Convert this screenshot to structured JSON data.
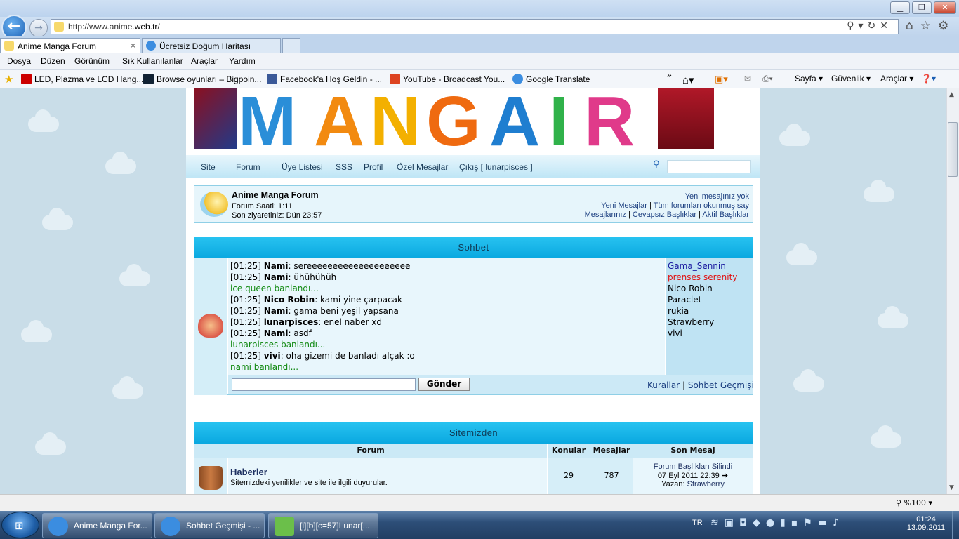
{
  "browser": {
    "url_prefix": "http://www.anime.",
    "url_domain": "web.tr",
    "url_suffix": "/",
    "tabs": [
      {
        "label": "Anime Manga Forum",
        "close": "×"
      },
      {
        "label": "Ücretsiz Doğum Haritası"
      }
    ],
    "menu": [
      "Dosya",
      "Düzen",
      "Görünüm",
      "Sık Kullanılanlar",
      "Araçlar",
      "Yardım"
    ],
    "favorites": [
      "LED, Plazma ve LCD Hang...",
      "Browse oyunları – Bigpoin...",
      "Facebook'a Hoş Geldin - ...",
      "YouTube - Broadcast You...",
      "Google Translate"
    ],
    "commands": [
      "Sayfa",
      "Güvenlik",
      "Araçlar"
    ],
    "zoom": "%100",
    "overflow": "»"
  },
  "site": {
    "nav": [
      "Site",
      "Forum",
      "Üye Listesi",
      "SSS",
      "Profil",
      "Özel Mesajlar",
      "Çıkış [ lunarpisces ]"
    ],
    "info": {
      "title": "Anime Manga Forum",
      "time": "Forum Saati: 1:11",
      "last_visit": "Son ziyaretiniz: Dün 23:57",
      "no_new": "Yeni mesajınız yok",
      "links1": [
        "Yeni Mesajlar",
        "Tüm forumları okunmuş say"
      ],
      "links2": [
        "Mesajlarınız",
        "Cevapsız Başlıklar",
        "Aktif Başlıklar"
      ]
    },
    "chat": {
      "header": "Sohbet",
      "lines": [
        {
          "t": "[01:25] ",
          "u": "Nami",
          "m": ": sereeeeeeeeeeeeeeeeeeee"
        },
        {
          "t": "[01:25] ",
          "u": "Nami",
          "m": ": ühühühüh"
        },
        {
          "sys": "ice queen banlandı..."
        },
        {
          "t": "[01:25] ",
          "u": "Nico Robin",
          "m": ": kami yine çarpacak"
        },
        {
          "t": "[01:25] ",
          "u": "Nami",
          "m": ": gama beni yeşil yapsana"
        },
        {
          "t": "[01:25] ",
          "u": "lunarpisces",
          "m": ": enel naber xd"
        },
        {
          "t": "[01:25] ",
          "u": "Nami",
          "m": ": asdf"
        },
        {
          "sys": "lunarpisces banlandı..."
        },
        {
          "t": "[01:25] ",
          "u": "vivi",
          "m": ": oha gizemi de banladı alçak :o"
        },
        {
          "sys": "nami banlandı..."
        }
      ],
      "users": [
        {
          "name": "Gama_Sennin",
          "color": "#1a1aa0"
        },
        {
          "name": "prenses serenity",
          "color": "#e01010"
        },
        {
          "name": "Nico Robin",
          "color": "#000000"
        },
        {
          "name": "Paraclet",
          "color": "#000000"
        },
        {
          "name": "rukia",
          "color": "#000000"
        },
        {
          "name": "Strawberry",
          "color": "#000000"
        },
        {
          "name": "vivi",
          "color": "#000000"
        }
      ],
      "send": "Gönder",
      "rules": "Kurallar",
      "sep": "|",
      "history": "Sohbet Geçmişi"
    },
    "sitemizden": {
      "header": "Sitemizden",
      "cols": [
        "Forum",
        "Konular",
        "Mesajlar",
        "Son Mesaj"
      ],
      "row": {
        "name": "Haberler",
        "desc": "Sitemizdeki yenilikler ve site ile ilgili duyurular.",
        "topics": "29",
        "posts": "787",
        "last_title": "Forum Başlıkları Silindi",
        "last_date": "07 Eyl 2011 22:39",
        "last_by_label": "Yazan:",
        "last_by": "Strawberry"
      }
    }
  },
  "taskbar": {
    "buttons": [
      "Anime Manga For...",
      "Sohbet Geçmişi - ...",
      "[i][b][c=57]Lunar[..."
    ],
    "lang": "TR",
    "time": "01:24",
    "date": "13.09.2011"
  }
}
